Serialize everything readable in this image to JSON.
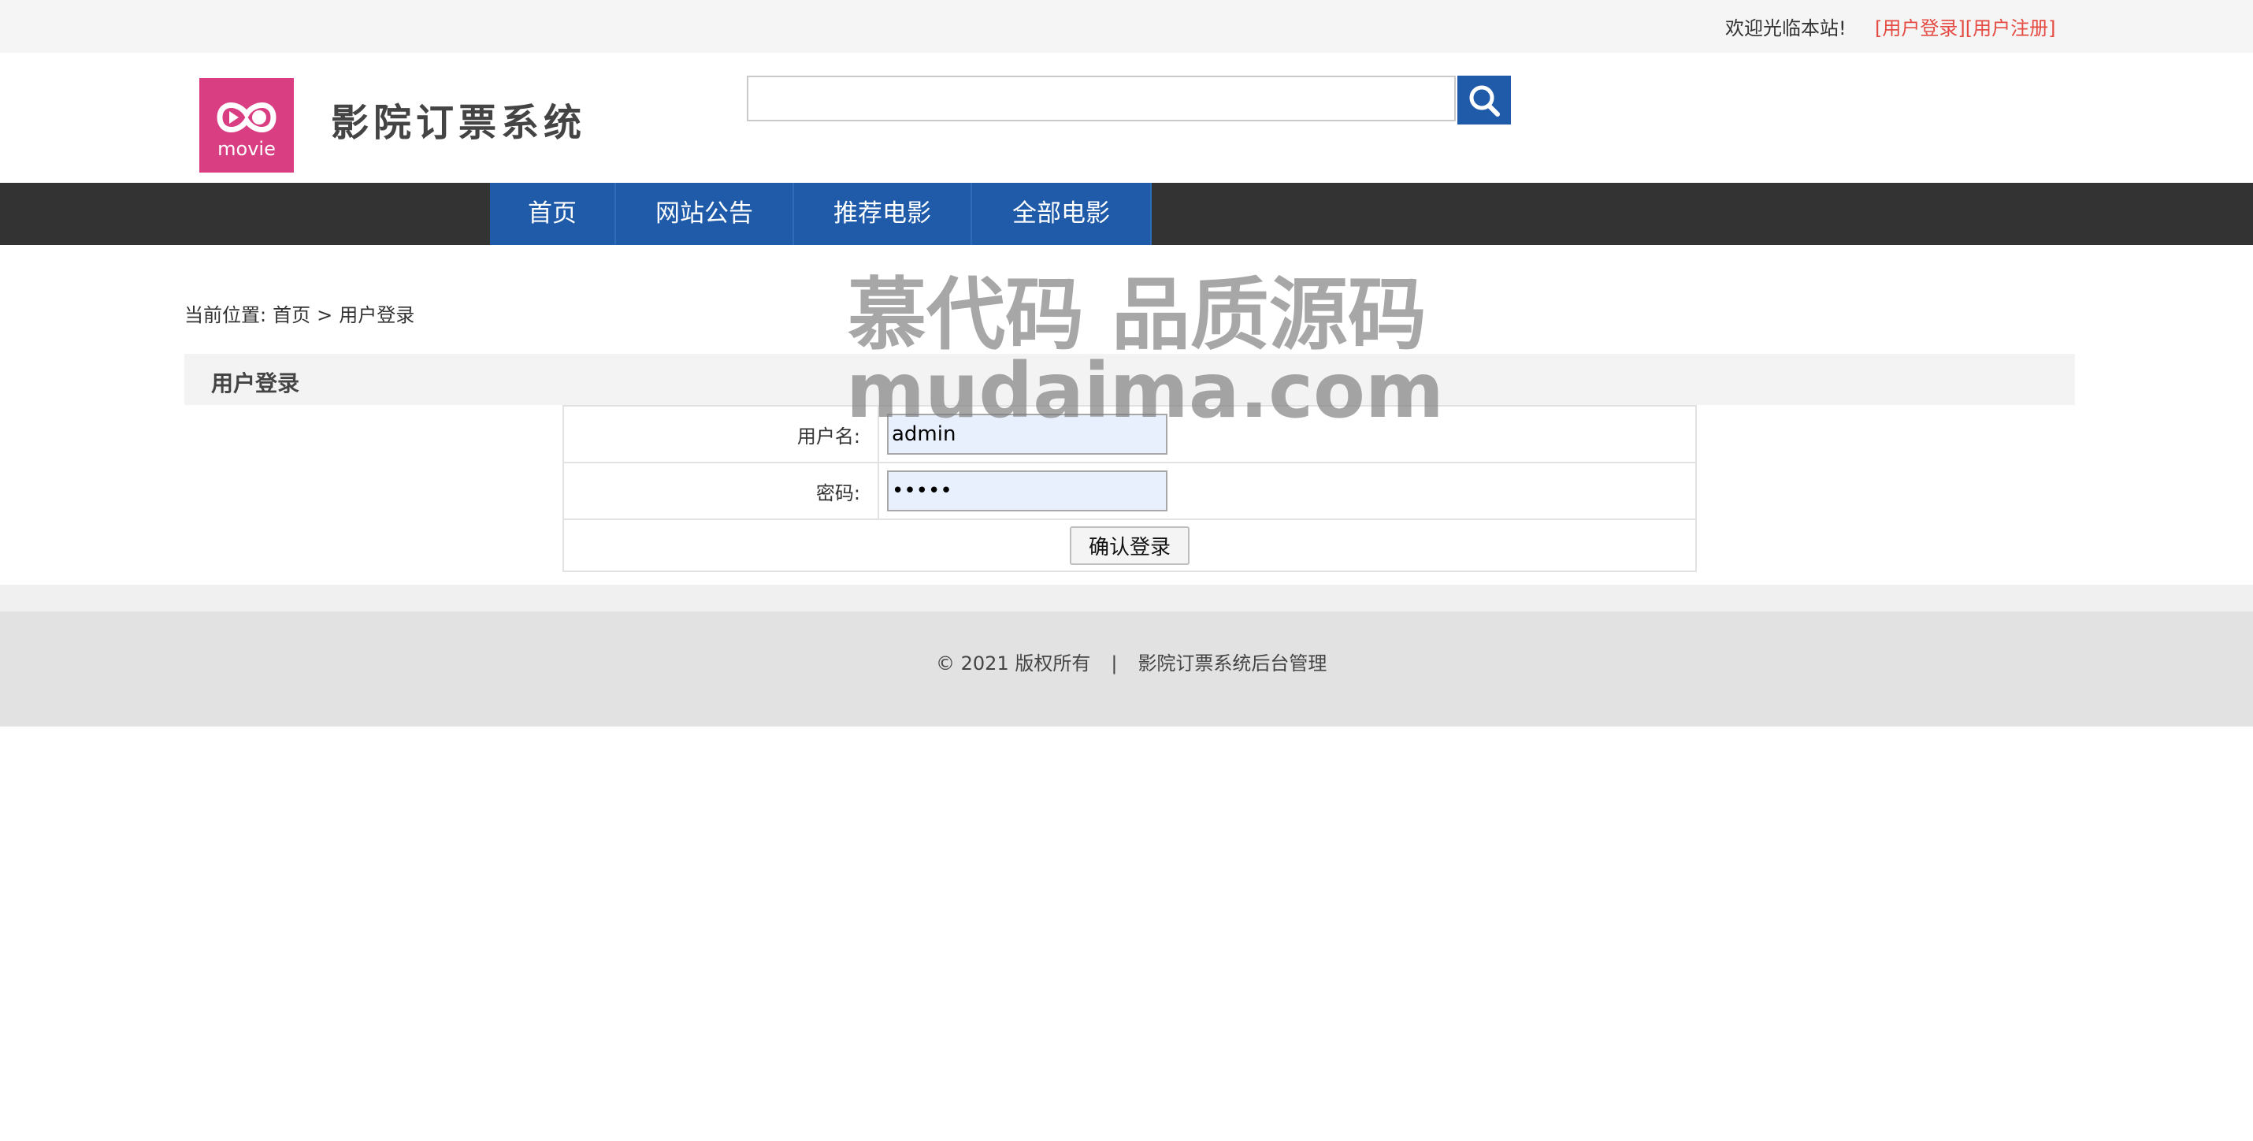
{
  "topbar": {
    "welcome": "欢迎光临本站!",
    "login_link": "[用户登录]",
    "register_link": "[用户注册]"
  },
  "header": {
    "logo_text": "movie",
    "site_title": "影院订票系统",
    "search": {
      "value": "",
      "placeholder": ""
    }
  },
  "nav": {
    "items": [
      "首页",
      "网站公告",
      "推荐电影",
      "全部电影"
    ]
  },
  "breadcrumb": {
    "prefix": "当前位置:",
    "home": "首页",
    "separator": ">",
    "current": "用户登录"
  },
  "panel": {
    "title": "用户登录"
  },
  "form": {
    "username_label": "用户名:",
    "username_value": "admin",
    "password_label": "密码:",
    "password_value": "•••••",
    "submit_label": "确认登录"
  },
  "footer": {
    "copyright": "© 2021 版权所有",
    "separator": "|",
    "admin_link": "影院订票系统后台管理"
  },
  "watermark": {
    "line1": "慕代码 品质源码",
    "line2": "mudaima.com"
  },
  "colors": {
    "nav_blue": "#1f5ba8",
    "nav_bar": "#333333",
    "logo_pink": "#d93e83",
    "link_red": "#e54b43"
  }
}
